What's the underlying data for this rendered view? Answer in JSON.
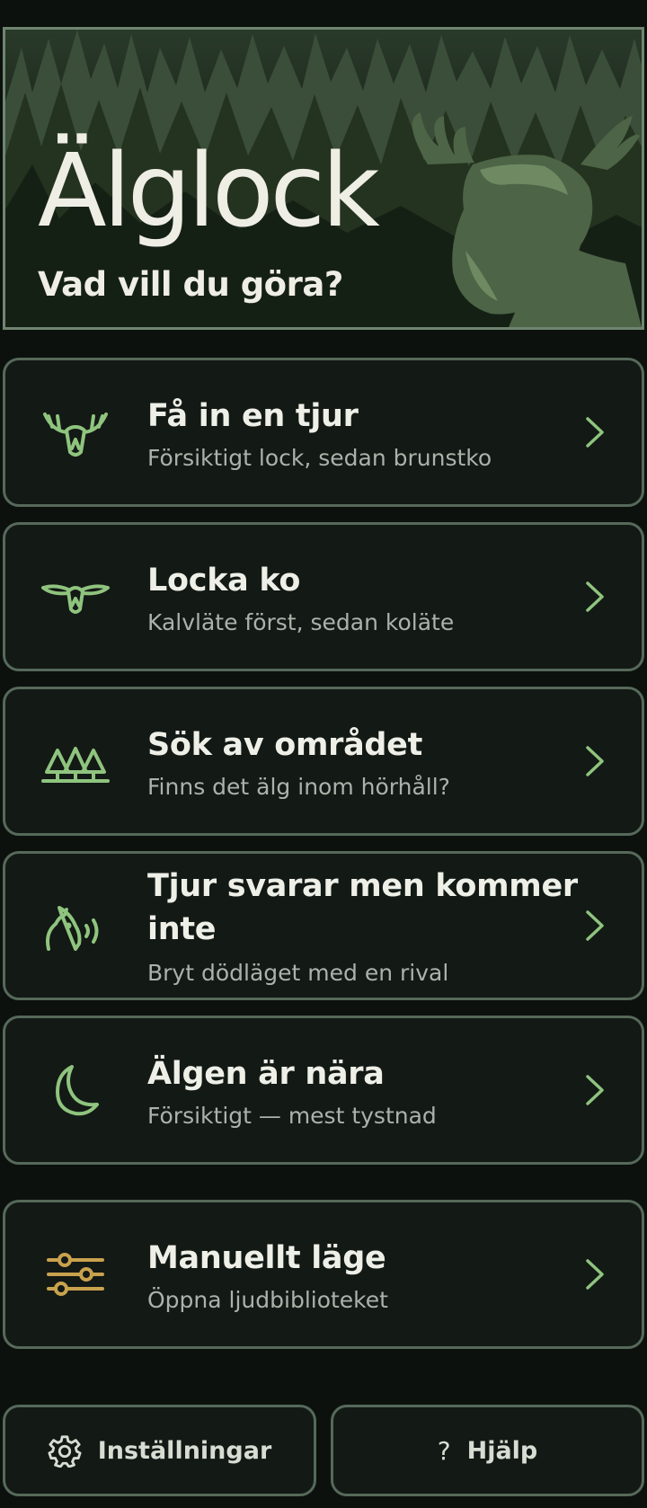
{
  "hero": {
    "title": "Älglock",
    "subtitle": "Vad vill du göra?"
  },
  "menu": [
    {
      "icon": "moose-bull-icon",
      "title": "Få in en tjur",
      "subtitle": "Försiktigt lock, sedan brunstko"
    },
    {
      "icon": "moose-cow-icon",
      "title": "Locka ko",
      "subtitle": "Kalvläte först, sedan koläte"
    },
    {
      "icon": "forest-icon",
      "title": "Sök av området",
      "subtitle": "Finns det älg inom hörhåll?"
    },
    {
      "icon": "calling-moose-icon",
      "title": "Tjur svarar men kommer inte",
      "subtitle": "Bryt dödläget med en rival"
    },
    {
      "icon": "moon-icon",
      "title": "Älgen är nära",
      "subtitle": "Försiktigt — mest tystnad"
    },
    {
      "icon": "sliders-icon",
      "title": "Manuellt läge",
      "subtitle": "Öppna ljudbiblioteket"
    }
  ],
  "footer": {
    "settings_label": "Inställningar",
    "help_symbol": "?",
    "help_label": "Hjälp"
  },
  "colors": {
    "accent_green": "#8fc47e",
    "accent_gold": "#c9a24e",
    "border": "#56695a",
    "card_bg": "#131915",
    "page_bg": "#0c110e"
  }
}
